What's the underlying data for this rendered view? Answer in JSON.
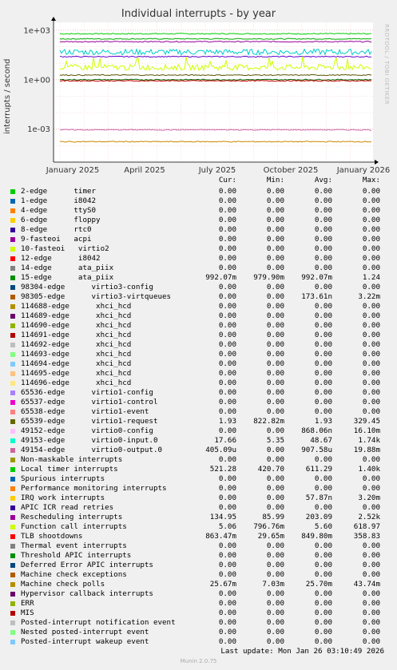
{
  "chart_data": {
    "type": "line",
    "title": "Individual interrupts - by year",
    "ylabel": "interrupts / second",
    "yscale": "log",
    "ylim": [
      1e-05,
      3000
    ],
    "yticks": [
      "1e+03",
      "1e+00",
      "1e-03"
    ],
    "xticks": [
      "January 2025",
      "April 2025",
      "July 2025",
      "October 2025",
      "January 2026"
    ],
    "grid": true,
    "series": [
      {
        "name": "Local timer interrupts",
        "color": "#00cc00",
        "level": 611
      },
      {
        "name": "14-edge ata_piix (ref)",
        "color": "#00aa00",
        "level": 300
      },
      {
        "name": "Rescheduling interrupts",
        "color": "#990099",
        "level": 203
      },
      {
        "name": "49153-edge virtio0-input.0",
        "color": "#00cccc",
        "level": 48
      },
      {
        "name": "Hypervisor callback",
        "color": "#6600cc",
        "level": 25
      },
      {
        "name": "Function call interrupts",
        "color": "#ccff00",
        "level": 5.6
      },
      {
        "name": "65539-edge virtio1-request",
        "color": "#555500",
        "level": 1.9
      },
      {
        "name": "15-edge ata_piix",
        "color": "#006600",
        "level": 1.0
      },
      {
        "name": "TLB shootdowns",
        "color": "#cc0000",
        "level": 0.85
      },
      {
        "name": "98305-edge virtio3-virtqueues",
        "color": "#cc8800",
        "level": 0.000174
      },
      {
        "name": "49154-edge virtio0-output.0",
        "color": "#cc66aa",
        "level": 0.00091
      }
    ]
  },
  "legend": {
    "headers": [
      "Cur:",
      "Min:",
      "Avg:",
      "Max:"
    ],
    "rows": [
      {
        "name": "2-edge      timer",
        "color": "#00cc00",
        "cur": "0.00",
        "min": "0.00",
        "avg": "0.00",
        "max": "0.00"
      },
      {
        "name": "1-edge      i8042",
        "color": "#0066b3",
        "cur": "0.00",
        "min": "0.00",
        "avg": "0.00",
        "max": "0.00"
      },
      {
        "name": "4-edge      ttyS0",
        "color": "#ff8000",
        "cur": "0.00",
        "min": "0.00",
        "avg": "0.00",
        "max": "0.00"
      },
      {
        "name": "6-edge      floppy",
        "color": "#ffcc00",
        "cur": "0.00",
        "min": "0.00",
        "avg": "0.00",
        "max": "0.00"
      },
      {
        "name": "8-edge      rtc0",
        "color": "#330099",
        "cur": "0.00",
        "min": "0.00",
        "avg": "0.00",
        "max": "0.00"
      },
      {
        "name": "9-fasteoi   acpi",
        "color": "#990099",
        "cur": "0.00",
        "min": "0.00",
        "avg": "0.00",
        "max": "0.00"
      },
      {
        "name": "10-fasteoi   virtio2",
        "color": "#ccff00",
        "cur": "0.00",
        "min": "0.00",
        "avg": "0.00",
        "max": "0.00"
      },
      {
        "name": "12-edge      i8042",
        "color": "#ff0000",
        "cur": "0.00",
        "min": "0.00",
        "avg": "0.00",
        "max": "0.00"
      },
      {
        "name": "14-edge      ata_piix",
        "color": "#808080",
        "cur": "0.00",
        "min": "0.00",
        "avg": "0.00",
        "max": "0.00"
      },
      {
        "name": "15-edge      ata_piix",
        "color": "#008f00",
        "cur": "992.07m",
        "min": "979.90m",
        "avg": "992.07m",
        "max": "1.24"
      },
      {
        "name": "98304-edge      virtio3-config",
        "color": "#00487d",
        "cur": "0.00",
        "min": "0.00",
        "avg": "0.00",
        "max": "0.00"
      },
      {
        "name": "98305-edge      virtio3-virtqueues",
        "color": "#b35a00",
        "cur": "0.00",
        "min": "0.00",
        "avg": "173.61n",
        "max": "3.22m"
      },
      {
        "name": "114688-edge      xhci_hcd",
        "color": "#b38f00",
        "cur": "0.00",
        "min": "0.00",
        "avg": "0.00",
        "max": "0.00"
      },
      {
        "name": "114689-edge      xhci_hcd",
        "color": "#6b006b",
        "cur": "0.00",
        "min": "0.00",
        "avg": "0.00",
        "max": "0.00"
      },
      {
        "name": "114690-edge      xhci_hcd",
        "color": "#8fb300",
        "cur": "0.00",
        "min": "0.00",
        "avg": "0.00",
        "max": "0.00"
      },
      {
        "name": "114691-edge      xhci_hcd",
        "color": "#b30000",
        "cur": "0.00",
        "min": "0.00",
        "avg": "0.00",
        "max": "0.00"
      },
      {
        "name": "114692-edge      xhci_hcd",
        "color": "#bebebe",
        "cur": "0.00",
        "min": "0.00",
        "avg": "0.00",
        "max": "0.00"
      },
      {
        "name": "114693-edge      xhci_hcd",
        "color": "#80ff80",
        "cur": "0.00",
        "min": "0.00",
        "avg": "0.00",
        "max": "0.00"
      },
      {
        "name": "114694-edge      xhci_hcd",
        "color": "#80c9ff",
        "cur": "0.00",
        "min": "0.00",
        "avg": "0.00",
        "max": "0.00"
      },
      {
        "name": "114695-edge      xhci_hcd",
        "color": "#ffc080",
        "cur": "0.00",
        "min": "0.00",
        "avg": "0.00",
        "max": "0.00"
      },
      {
        "name": "114696-edge      xhci_hcd",
        "color": "#ffe680",
        "cur": "0.00",
        "min": "0.00",
        "avg": "0.00",
        "max": "0.00"
      },
      {
        "name": "65536-edge      virtio1-config",
        "color": "#aa80ff",
        "cur": "0.00",
        "min": "0.00",
        "avg": "0.00",
        "max": "0.00"
      },
      {
        "name": "65537-edge      virtio1-control",
        "color": "#ee00cc",
        "cur": "0.00",
        "min": "0.00",
        "avg": "0.00",
        "max": "0.00"
      },
      {
        "name": "65538-edge      virtio1-event",
        "color": "#ff8080",
        "cur": "0.00",
        "min": "0.00",
        "avg": "0.00",
        "max": "0.00"
      },
      {
        "name": "65539-edge      virtio1-request",
        "color": "#666600",
        "cur": "1.93",
        "min": "822.82m",
        "avg": "1.93",
        "max": "329.45"
      },
      {
        "name": "49152-edge      virtio0-config",
        "color": "#ffbfff",
        "cur": "0.00",
        "min": "0.00",
        "avg": "868.06n",
        "max": "16.10m"
      },
      {
        "name": "49153-edge      virtio0-input.0",
        "color": "#00ffcc",
        "cur": "17.66",
        "min": "5.35",
        "avg": "48.67",
        "max": "1.74k"
      },
      {
        "name": "49154-edge      virtio0-output.0",
        "color": "#cc6699",
        "cur": "405.09u",
        "min": "0.00",
        "avg": "907.58u",
        "max": "19.88m"
      },
      {
        "name": "Non-maskable interrupts",
        "color": "#999900",
        "cur": "0.00",
        "min": "0.00",
        "avg": "0.00",
        "max": "0.00"
      },
      {
        "name": "Local timer interrupts",
        "color": "#00cc00",
        "cur": "521.28",
        "min": "420.70",
        "avg": "611.29",
        "max": "1.40k"
      },
      {
        "name": "Spurious interrupts",
        "color": "#0066b3",
        "cur": "0.00",
        "min": "0.00",
        "avg": "0.00",
        "max": "0.00"
      },
      {
        "name": "Performance monitoring interrupts",
        "color": "#ff8000",
        "cur": "0.00",
        "min": "0.00",
        "avg": "0.00",
        "max": "0.00"
      },
      {
        "name": "IRQ work interrupts",
        "color": "#ffcc00",
        "cur": "0.00",
        "min": "0.00",
        "avg": "57.87n",
        "max": "3.20m"
      },
      {
        "name": "APIC ICR read retries",
        "color": "#330099",
        "cur": "0.00",
        "min": "0.00",
        "avg": "0.00",
        "max": "0.00"
      },
      {
        "name": "Rescheduling interrupts",
        "color": "#990099",
        "cur": "134.95",
        "min": "85.99",
        "avg": "203.09",
        "max": "2.52k"
      },
      {
        "name": "Function call interrupts",
        "color": "#ccff00",
        "cur": "5.06",
        "min": "796.76m",
        "avg": "5.60",
        "max": "618.97"
      },
      {
        "name": "TLB shootdowns",
        "color": "#ff0000",
        "cur": "863.47m",
        "min": "29.65m",
        "avg": "849.80m",
        "max": "358.83"
      },
      {
        "name": "Thermal event interrupts",
        "color": "#808080",
        "cur": "0.00",
        "min": "0.00",
        "avg": "0.00",
        "max": "0.00"
      },
      {
        "name": "Threshold APIC interrupts",
        "color": "#008f00",
        "cur": "0.00",
        "min": "0.00",
        "avg": "0.00",
        "max": "0.00"
      },
      {
        "name": "Deferred Error APIC interrupts",
        "color": "#00487d",
        "cur": "0.00",
        "min": "0.00",
        "avg": "0.00",
        "max": "0.00"
      },
      {
        "name": "Machine check exceptions",
        "color": "#b35a00",
        "cur": "0.00",
        "min": "0.00",
        "avg": "0.00",
        "max": "0.00"
      },
      {
        "name": "Machine check polls",
        "color": "#b38f00",
        "cur": "25.67m",
        "min": "7.03m",
        "avg": "25.70m",
        "max": "43.74m"
      },
      {
        "name": "Hypervisor callback interrupts",
        "color": "#6b006b",
        "cur": "0.00",
        "min": "0.00",
        "avg": "0.00",
        "max": "0.00"
      },
      {
        "name": "ERR",
        "color": "#8fb300",
        "cur": "0.00",
        "min": "0.00",
        "avg": "0.00",
        "max": "0.00"
      },
      {
        "name": "MIS",
        "color": "#b30000",
        "cur": "0.00",
        "min": "0.00",
        "avg": "0.00",
        "max": "0.00"
      },
      {
        "name": "Posted-interrupt notification event",
        "color": "#bebebe",
        "cur": "0.00",
        "min": "0.00",
        "avg": "0.00",
        "max": "0.00"
      },
      {
        "name": "Nested posted-interrupt event",
        "color": "#80ff80",
        "cur": "0.00",
        "min": "0.00",
        "avg": "0.00",
        "max": "0.00"
      },
      {
        "name": "Posted-interrupt wakeup event",
        "color": "#80c9ff",
        "cur": "0.00",
        "min": "0.00",
        "avg": "0.00",
        "max": "0.00"
      }
    ]
  },
  "last_update": "Last update: Mon Jan 26 03:10:49 2026",
  "footer": "Munin 2.0.75",
  "side_credit": "RRDTOOL / TOBI OETIKER"
}
